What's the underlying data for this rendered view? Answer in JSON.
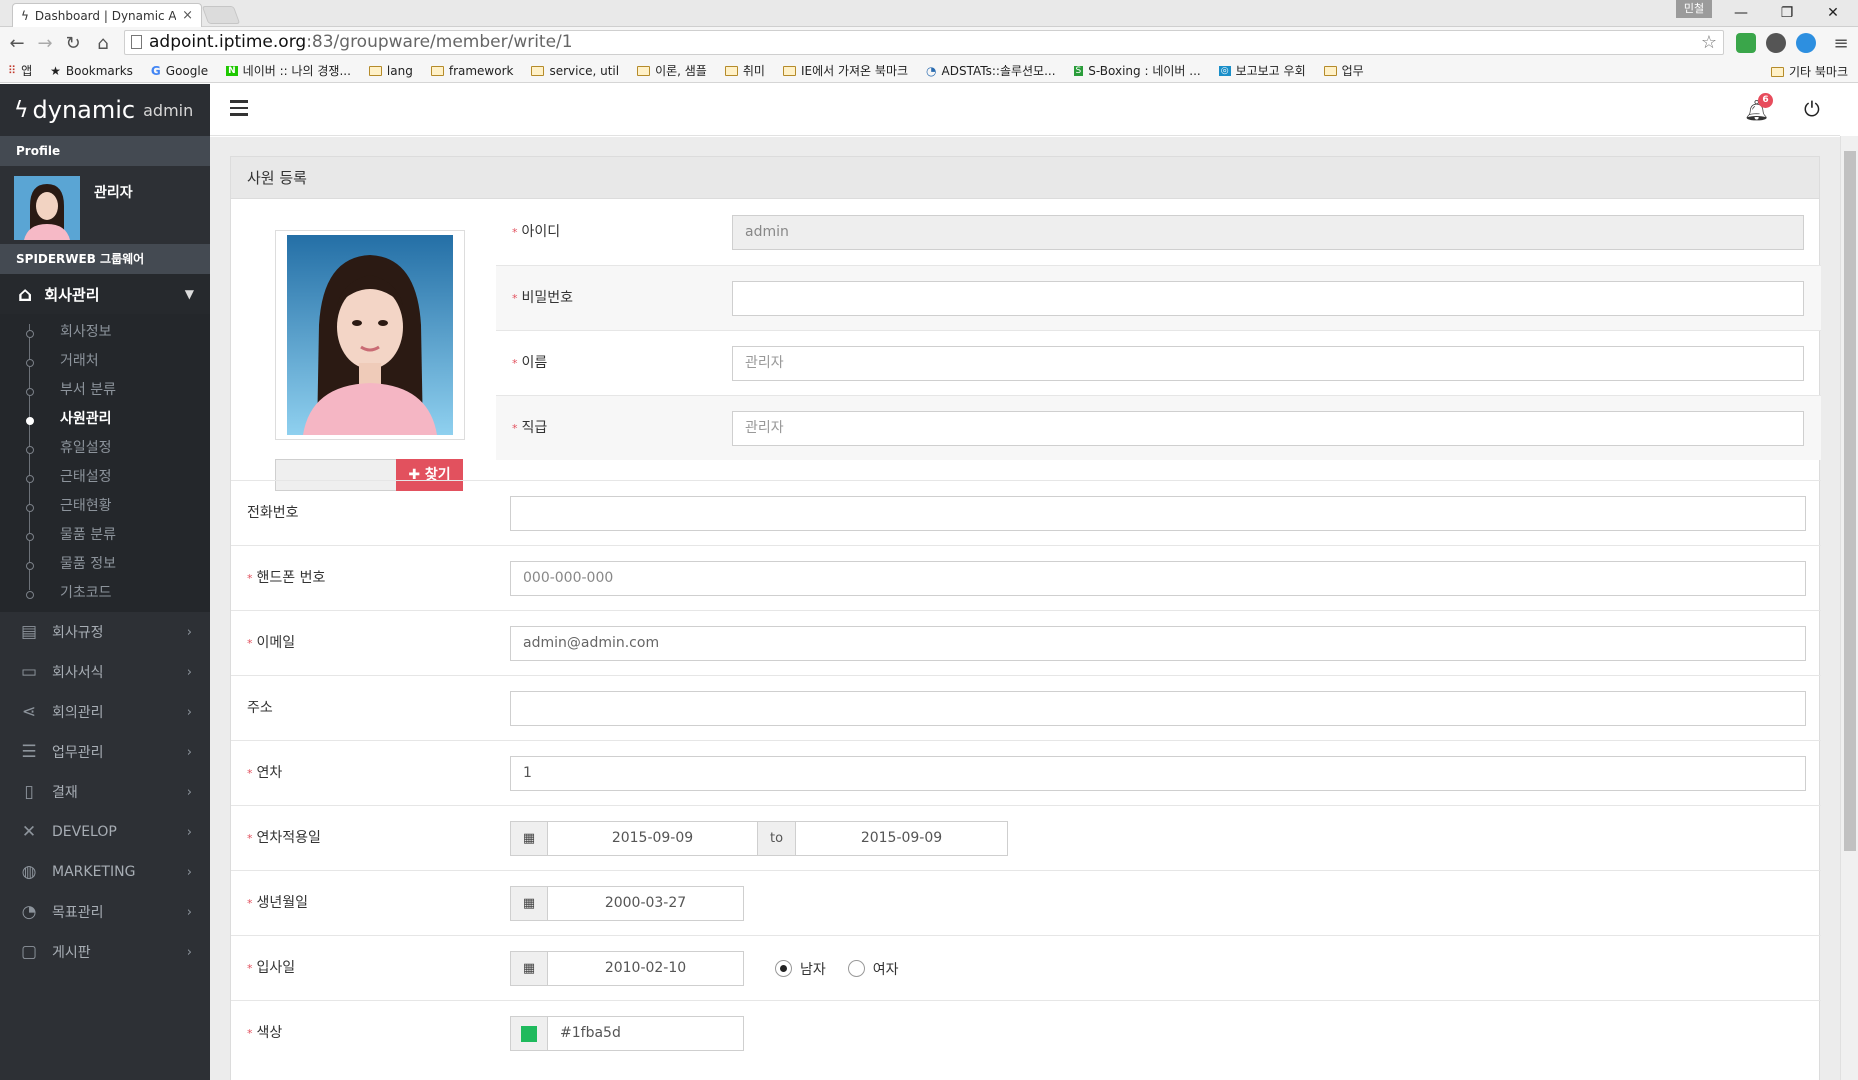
{
  "browser": {
    "tab_title": "Dashboard | Dynamic Ad",
    "tab_close": "×",
    "user_chip": "민철",
    "url_host": "adpoint.iptime.org",
    "url_path": ":83/groupware/member/write/1",
    "bookmarks": [
      {
        "label": "앱",
        "icon": "apps-icon"
      },
      {
        "label": "Bookmarks",
        "icon": "star-icon"
      },
      {
        "label": "Google",
        "icon": "google-icon"
      },
      {
        "label": "네이버 :: 나의 경쟁...",
        "icon": "naver-icon"
      },
      {
        "label": "lang",
        "icon": "folder-icon"
      },
      {
        "label": "framework",
        "icon": "folder-icon"
      },
      {
        "label": "service, util",
        "icon": "folder-icon"
      },
      {
        "label": "이론, 샘플",
        "icon": "folder-icon"
      },
      {
        "label": "취미",
        "icon": "folder-icon"
      },
      {
        "label": "IE에서 가져온 북마크",
        "icon": "folder-icon"
      },
      {
        "label": "ADSTATs::솔루션모...",
        "icon": "adstats-icon"
      },
      {
        "label": "S-Boxing : 네이버 ...",
        "icon": "sboxing-icon"
      },
      {
        "label": "보고보고 우회",
        "icon": "bogo-icon"
      },
      {
        "label": "업무",
        "icon": "folder-icon"
      }
    ],
    "other_bookmarks": "기타 북마크"
  },
  "sidebar": {
    "logo_main": "dynamic",
    "logo_sub": "admin",
    "profile_section": "Profile",
    "profile_name": "관리자",
    "group_section": "SPIDERWEB 그룹웨어",
    "active_menu": "회사관리",
    "submenu": [
      "회사정보",
      "거래처",
      "부서 분류",
      "사원관리",
      "휴일설정",
      "근태설정",
      "근태현황",
      "물품 분류",
      "물품 정보",
      "기초코드"
    ],
    "active_submenu_index": 3,
    "menu": [
      {
        "label": "회사규정",
        "icon": "document-icon"
      },
      {
        "label": "회사서식",
        "icon": "folder-icon"
      },
      {
        "label": "회의관리",
        "icon": "share-icon"
      },
      {
        "label": "업무관리",
        "icon": "database-icon"
      },
      {
        "label": "결재",
        "icon": "clipboard-icon"
      },
      {
        "label": "DEVELOP",
        "icon": "tools-icon"
      },
      {
        "label": "MARKETING",
        "icon": "globe-icon"
      },
      {
        "label": "목표관리",
        "icon": "pie-chart-icon"
      },
      {
        "label": "게시판",
        "icon": "comment-icon"
      }
    ]
  },
  "header": {
    "notification_count": "6"
  },
  "form": {
    "title": "사원 등록",
    "find_button": "찾기",
    "fields": {
      "id": {
        "label": "아이디",
        "value": "admin"
      },
      "password": {
        "label": "비밀번호",
        "value": ""
      },
      "name": {
        "label": "이름",
        "placeholder": "관리자"
      },
      "position": {
        "label": "직급",
        "placeholder": "관리자"
      },
      "phone": {
        "label": "전화번호",
        "value": ""
      },
      "mobile": {
        "label": "핸드폰 번호",
        "placeholder": "000-000-000"
      },
      "email": {
        "label": "이메일",
        "value": "admin@admin.com"
      },
      "address": {
        "label": "주소",
        "value": ""
      },
      "leave": {
        "label": "연차",
        "value": "1"
      },
      "leave_period": {
        "label": "연차적용일",
        "from": "2015-09-09",
        "to_label": "to",
        "to": "2015-09-09"
      },
      "birth": {
        "label": "생년월일",
        "value": "2000-03-27"
      },
      "hire": {
        "label": "입사일",
        "value": "2010-02-10"
      },
      "gender": {
        "male": "남자",
        "female": "여자",
        "selected": "남자"
      },
      "color": {
        "label": "색상",
        "value": "#1fba5d",
        "swatch": "#1fba5d"
      }
    }
  }
}
